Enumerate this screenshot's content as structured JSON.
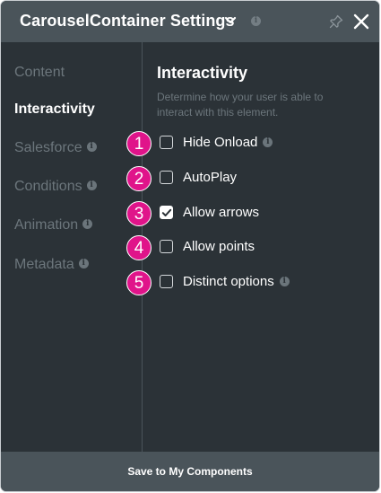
{
  "header": {
    "title": "CarouselContainer Settings",
    "info": "i"
  },
  "sidebar": {
    "items": [
      {
        "label": "Content",
        "info": ""
      },
      {
        "label": "Interactivity",
        "info": ""
      },
      {
        "label": "Salesforce",
        "info": "i"
      },
      {
        "label": "Conditions",
        "info": "i"
      },
      {
        "label": "Animation",
        "info": "i"
      },
      {
        "label": "Metadata",
        "info": "i"
      }
    ]
  },
  "main": {
    "title": "Interactivity",
    "description": "Determine how your user is able to interact with this element.",
    "options": [
      {
        "badge": "1",
        "label": "Hide Onload",
        "checked": false,
        "info": "i"
      },
      {
        "badge": "2",
        "label": "AutoPlay",
        "checked": false,
        "info": ""
      },
      {
        "badge": "3",
        "label": "Allow arrows",
        "checked": true,
        "info": ""
      },
      {
        "badge": "4",
        "label": "Allow points",
        "checked": false,
        "info": ""
      },
      {
        "badge": "5",
        "label": "Distinct options",
        "checked": false,
        "info": "i"
      }
    ]
  },
  "footer": {
    "save_label": "Save to My Components"
  },
  "colors": {
    "panel_bg": "#2b3237",
    "header_bg": "#4a545a",
    "badge_accent": "#e0148a",
    "muted_text": "#6c767c"
  },
  "icons": [
    "chevron-down-icon",
    "info-icon",
    "pin-icon",
    "close-icon",
    "check-icon"
  ]
}
